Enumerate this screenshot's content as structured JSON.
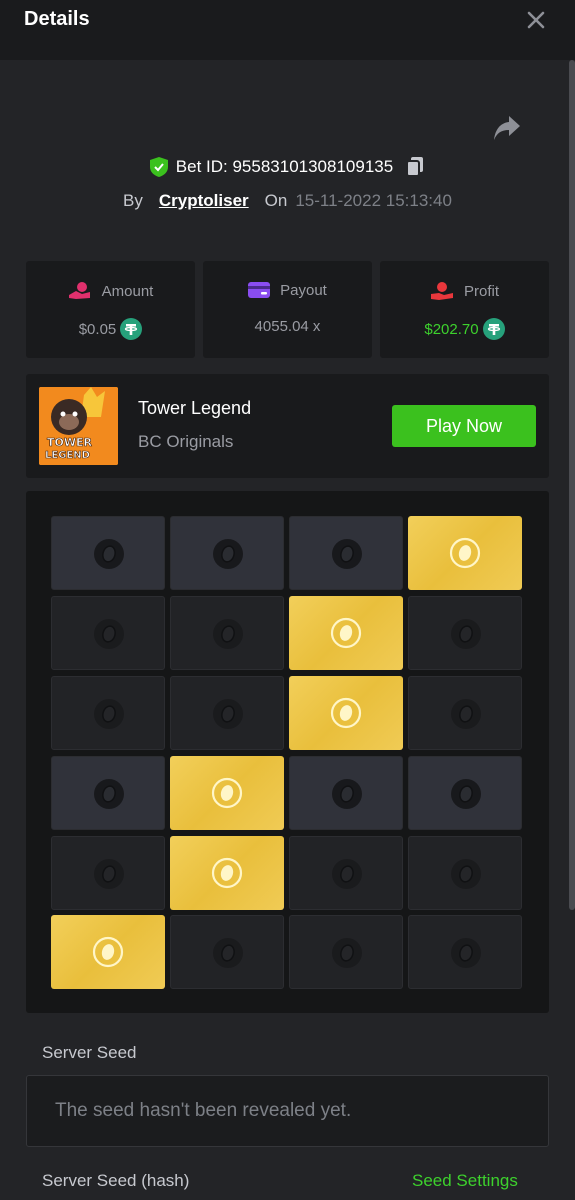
{
  "header": {
    "title": "Details",
    "close_icon": "close-icon"
  },
  "bet": {
    "id_label": "Bet ID: 95583101308109135",
    "by_label": "By",
    "username": "Cryptoliser",
    "on_label": "On",
    "datetime": "15-11-2022 15:13:40"
  },
  "stats": [
    {
      "label": "Amount",
      "value": "$0.05",
      "icon": "coin-hand-icon",
      "color": "#e0306d"
    },
    {
      "label": "Payout",
      "value": "4055.04 x",
      "icon": "wallet-icon",
      "color": "#8a4df0"
    },
    {
      "label": "Profit",
      "value": "$202.70",
      "icon": "hand-coin-icon",
      "color": "#e9373c"
    }
  ],
  "game": {
    "thumb_text": "TOWER LEGEND",
    "title": "Tower Legend",
    "provider": "BC Originals",
    "play_label": "Play Now"
  },
  "board": {
    "rows": [
      [
        "lit",
        "lit",
        "lit",
        "gold"
      ],
      [
        "dark",
        "dark",
        "gold",
        "dark"
      ],
      [
        "dark",
        "dark",
        "gold",
        "dark"
      ],
      [
        "lit",
        "gold",
        "lit",
        "lit"
      ],
      [
        "dark",
        "gold",
        "dark",
        "dark"
      ],
      [
        "gold",
        "dark",
        "dark",
        "dark"
      ]
    ]
  },
  "seed": {
    "server_seed_label": "Server Seed",
    "server_seed_value": "The seed hasn't been revealed yet.",
    "server_seed_hash_label": "Server Seed (hash)",
    "seed_settings_label": "Seed Settings"
  },
  "colors": {
    "accent_green": "#3bc11e",
    "gold": "#f0cb55",
    "background": "#232427"
  }
}
